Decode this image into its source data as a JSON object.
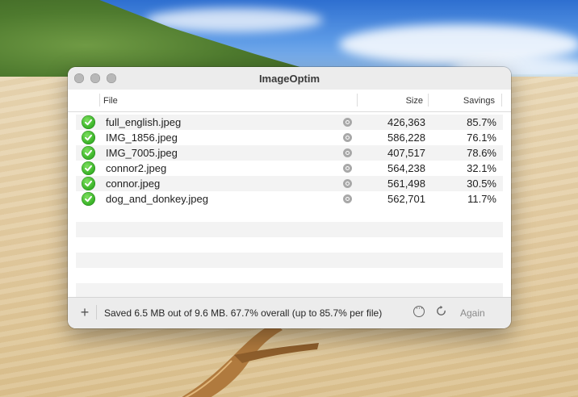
{
  "window": {
    "title": "ImageOptim"
  },
  "columns": {
    "file": "File",
    "size": "Size",
    "savings": "Savings"
  },
  "files": [
    {
      "name": "full_english.jpeg",
      "size": "426,363",
      "savings": "85.7%"
    },
    {
      "name": "IMG_1856.jpeg",
      "size": "586,228",
      "savings": "76.1%"
    },
    {
      "name": "IMG_7005.jpeg",
      "size": "407,517",
      "savings": "78.6%"
    },
    {
      "name": "connor2.jpeg",
      "size": "564,238",
      "savings": "32.1%"
    },
    {
      "name": "connor.jpeg",
      "size": "561,498",
      "savings": "30.5%"
    },
    {
      "name": "dog_and_donkey.jpeg",
      "size": "562,701",
      "savings": "11.7%"
    }
  ],
  "footer": {
    "add_label": "+",
    "status": "Saved 6.5 MB out of 9.6 MB. 67.7% overall (up to 85.7% per file)",
    "again_label": "Again"
  },
  "icons": {
    "status_ok": "check-circle-icon",
    "file_preview": "magnifier-icon",
    "more": "ellipsis-circle-icon",
    "refresh": "refresh-icon"
  },
  "colors": {
    "success": "#3db52a",
    "accent_disabled": "#8a8a8a"
  }
}
